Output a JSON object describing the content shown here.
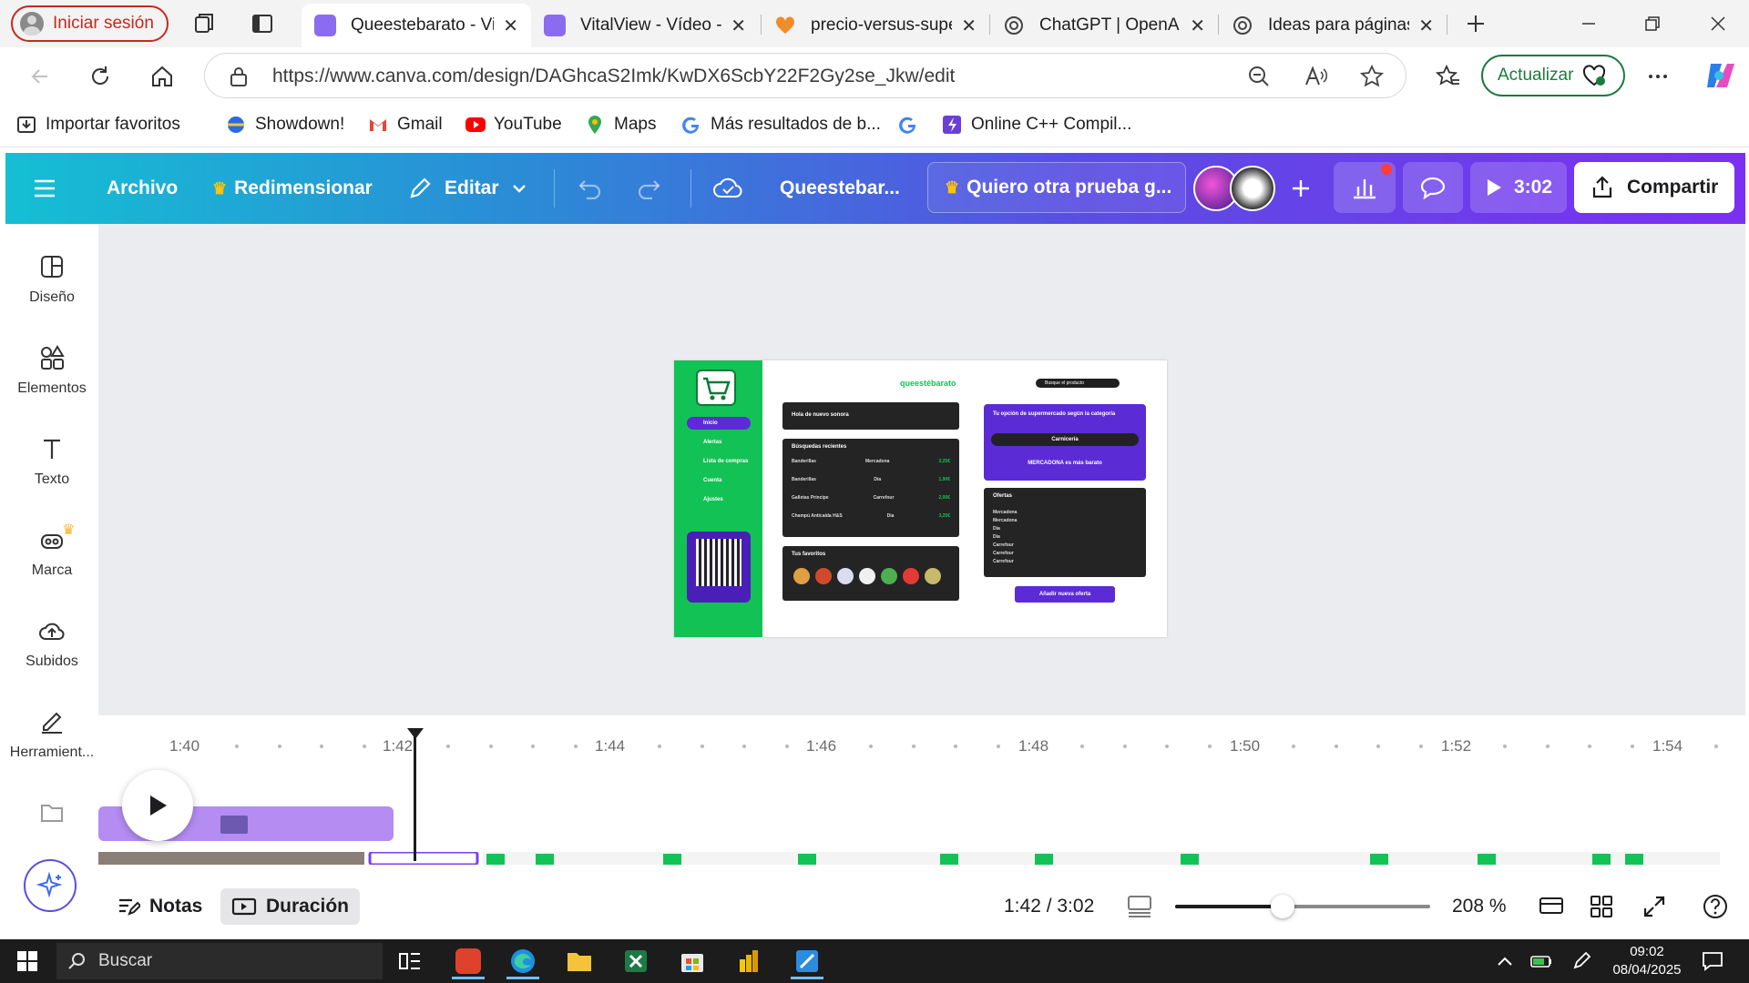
{
  "browser": {
    "profile_label": "Iniciar sesión",
    "tabs": [
      {
        "title": "Queestebarato - Vi",
        "favicon": "canva-video-icon",
        "active": true
      },
      {
        "title": "VitalView - Vídeo -",
        "favicon": "canva-video-icon",
        "active": false
      },
      {
        "title": "precio-versus-supe",
        "favicon": "heart-icon",
        "active": false
      },
      {
        "title": "ChatGPT | OpenAI",
        "favicon": "openai-icon",
        "active": false
      },
      {
        "title": "Ideas para páginas",
        "favicon": "openai-icon",
        "active": false
      }
    ],
    "url": "https://www.canva.com/design/DAGhcaS2Imk/KwDX6ScbY22F2Gy2se_Jkw/edit",
    "update_label": "Actualizar",
    "bookmarks": [
      {
        "label": "Importar favoritos",
        "icon": "import-icon"
      },
      {
        "label": "Showdown!",
        "icon": "showdown-icon"
      },
      {
        "label": "Gmail",
        "icon": "gmail-icon"
      },
      {
        "label": "YouTube",
        "icon": "youtube-icon"
      },
      {
        "label": "Maps",
        "icon": "maps-icon"
      },
      {
        "label": "Más resultados de b...",
        "icon": "google-icon"
      },
      {
        "label": "",
        "icon": "google-icon"
      },
      {
        "label": "Online C++ Compil...",
        "icon": "compiler-icon"
      }
    ]
  },
  "canva": {
    "header": {
      "archivo": "Archivo",
      "redimensionar": "Redimensionar",
      "editar": "Editar",
      "title": "Queestebar...",
      "promo": "Quiero otra prueba g...",
      "present_time": "3:02",
      "share": "Compartir"
    },
    "sidebar": [
      {
        "label": "Diseño",
        "icon": "layout-icon"
      },
      {
        "label": "Elementos",
        "icon": "shapes-icon"
      },
      {
        "label": "Texto",
        "icon": "text-icon"
      },
      {
        "label": "Marca",
        "icon": "brand-icon"
      },
      {
        "label": "Subidos",
        "icon": "cloud-upload-icon"
      },
      {
        "label": "Herramient...",
        "icon": "pen-tool-icon"
      },
      {
        "label": "",
        "icon": "folder-icon"
      }
    ],
    "design": {
      "brand": "queestébarato",
      "search_placeholder": "Busque el producto",
      "nav": [
        "Inicio",
        "Alertas",
        "Lista de compras",
        "Cuenta",
        "Ajustes"
      ],
      "greeting": "Hola de nuevo sonora",
      "recent_title": "Búsquedas recientes",
      "recent": [
        {
          "item": "Banderillas",
          "store": "Mercadona",
          "price": "2,25€"
        },
        {
          "item": "Banderillas",
          "store": "Dia",
          "price": "1,90€"
        },
        {
          "item": "Galletas Príncipe",
          "store": "Carrefour",
          "price": "2,00€"
        },
        {
          "item": "Champú Anticaída H&S",
          "store": "Dia",
          "price": "3,25€"
        }
      ],
      "favorites_title": "Tus favoritos",
      "category_title": "Tu opción de supermercado según la categoría",
      "category_select": "Carnicería",
      "category_result": "MERCADONA es más barato",
      "offers_title": "Ofertas",
      "offers": [
        "Mercadona",
        "Mercadona",
        "Dia",
        "Dia",
        "Carrefour",
        "Carrefour",
        "Carrefour"
      ],
      "add_offer": "Añadir nueva oferta"
    },
    "timeline": {
      "ticks": [
        "1:40",
        "1:42",
        "1:44",
        "1:46",
        "1:48",
        "1:50",
        "1:52",
        "1:54"
      ]
    },
    "bottom": {
      "notes": "Notas",
      "duration": "Duración",
      "time": "1:42 / 3:02",
      "zoom": "208 %",
      "zoom_level": 0.42
    }
  },
  "taskbar": {
    "search_placeholder": "Buscar",
    "time": "09:02",
    "date": "08/04/2025"
  },
  "colors": {
    "canva_gradient_start": "#15bfd4",
    "canva_gradient_end": "#7b2ff2",
    "design_green": "#13c255",
    "design_purple": "#5b2bd6",
    "profile_red": "#c42b1c"
  }
}
